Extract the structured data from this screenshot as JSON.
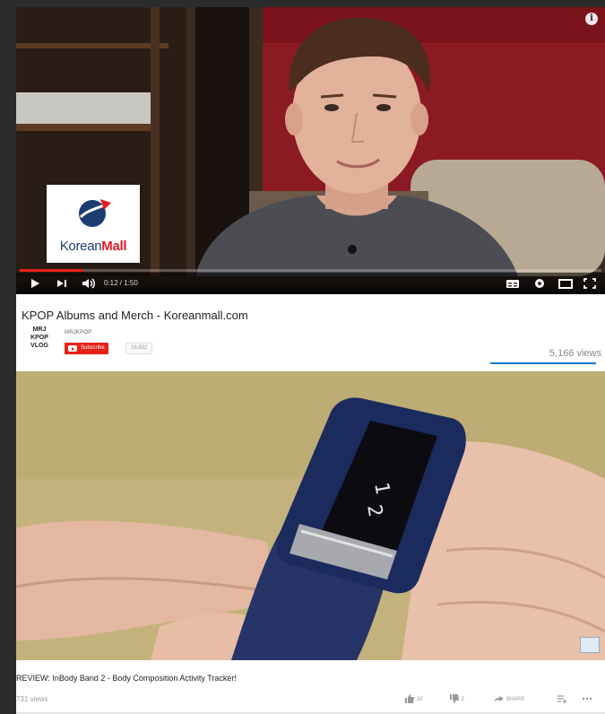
{
  "video1": {
    "info_icon": "i",
    "logo": {
      "text_main": "Korean",
      "text_accent": "Mall",
      "icon": "koreanmall-logo-icon"
    },
    "player": {
      "time": "0:12 / 1:50",
      "progress_fraction": 0.11,
      "icons": [
        "play-icon",
        "next-icon",
        "volume-icon",
        "captions-icon",
        "settings-icon",
        "theater-icon",
        "fullscreen-icon"
      ]
    },
    "title": "KPOP Albums and Merch - Koreanmall.com",
    "channel": {
      "logo_lines": [
        "MRJ",
        "KPOP",
        "VLOG"
      ],
      "name": "MRJKPOP",
      "subscribe_label": "Subscribe",
      "subscriber_count": "16,832"
    },
    "views": "5,166 views"
  },
  "video2": {
    "title": "REVIEW: InBody Band 2 - Body Composition Activity Tracker!",
    "views": "731 views",
    "actions": {
      "like_count": "10",
      "dislike_count": "2",
      "share_label": "SHARE"
    }
  },
  "colors": {
    "accent": "#e62117",
    "link": "#167ac6",
    "background": "#2b2b2b"
  }
}
